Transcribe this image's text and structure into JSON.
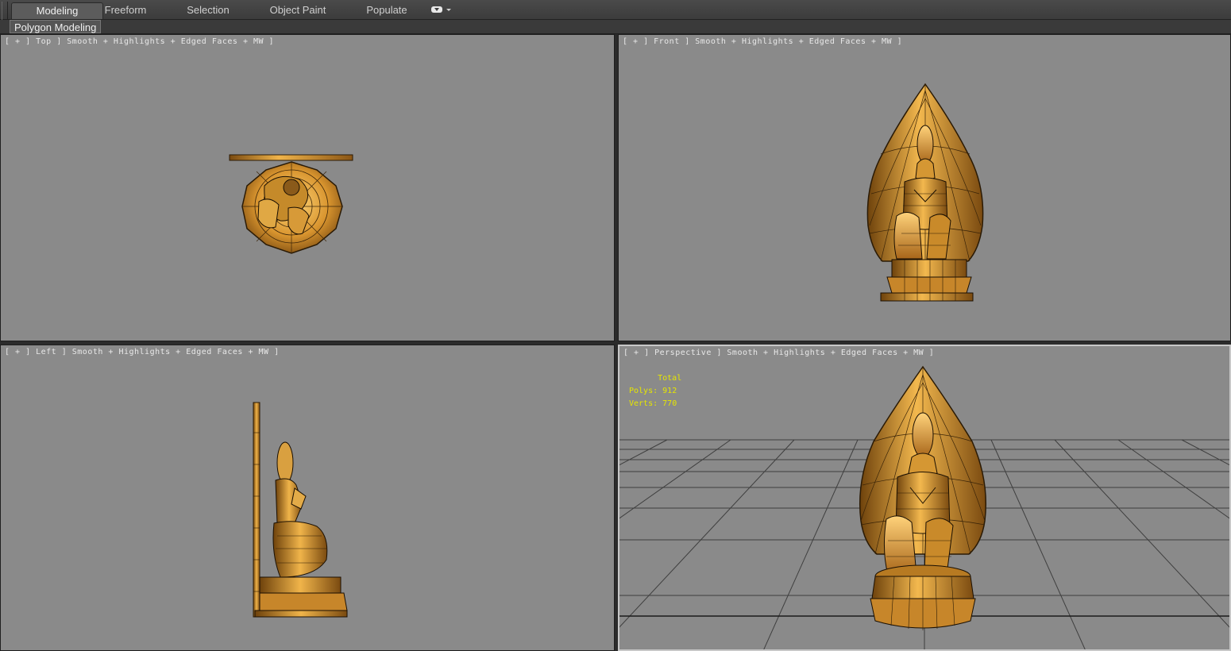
{
  "ribbon": {
    "tabs": [
      {
        "label": "Modeling",
        "active": true
      },
      {
        "label": "Freeform",
        "active": false
      },
      {
        "label": "Selection",
        "active": false
      },
      {
        "label": "Object Paint",
        "active": false
      },
      {
        "label": "Populate",
        "active": false
      }
    ],
    "dropdown_icon": "dropdown-icon"
  },
  "subtabs": {
    "polygon_modeling": "Polygon Modeling"
  },
  "viewports": {
    "top": {
      "label": "[ + ] Top ] Smooth + Highlights + Edged Faces + MW ]"
    },
    "front": {
      "label": "[ + ] Front ] Smooth + Highlights + Edged Faces + MW ]"
    },
    "left": {
      "label": "[ + ] Left ] Smooth + Highlights + Edged Faces + MW ]"
    },
    "perspective": {
      "label": "[ + ] Perspective ] Smooth + Highlights + Edged Faces + MW ]",
      "stats": {
        "title": "Total",
        "polys_label": "Polys:",
        "polys_value": "912",
        "verts_label": "Verts:",
        "verts_value": "770"
      }
    }
  },
  "colors": {
    "viewport_bg": "#8a8a8a",
    "model_gold": "#c98a2a",
    "stats_text": "#e6e600"
  }
}
